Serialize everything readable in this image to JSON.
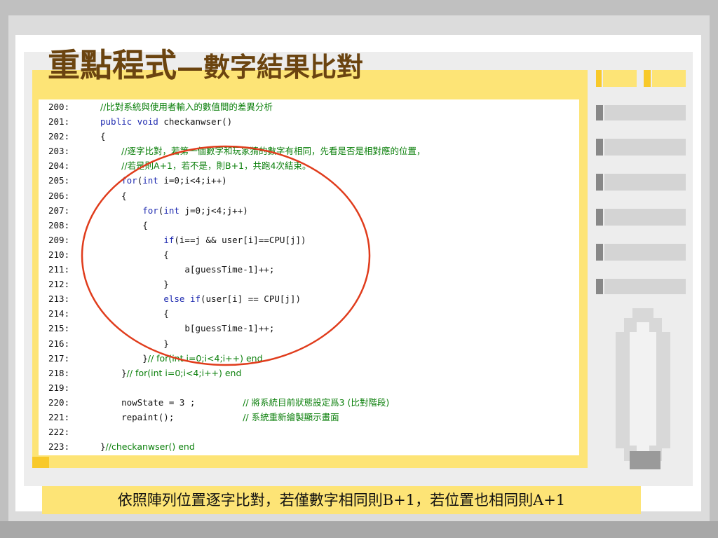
{
  "title": {
    "main": "重點程式",
    "sub": "—數字結果比對"
  },
  "code_lines": [
    {
      "num": "200:",
      "parts": [
        {
          "text": "//比對系統與使用者輸入的數值間的差異分析",
          "type": "comment"
        }
      ]
    },
    {
      "num": "201:",
      "parts": [
        {
          "text": "public void ",
          "type": "keyword"
        },
        {
          "text": "checkanwser()",
          "type": "plain"
        }
      ]
    },
    {
      "num": "202:",
      "parts": [
        {
          "text": "{",
          "type": "plain"
        }
      ]
    },
    {
      "num": "203:",
      "parts": [
        {
          "text": "    ",
          "type": "plain"
        },
        {
          "text": "//逐字比對，若第一個數字和玩家猜的數字有相同，先看是否是相對應的位置，",
          "type": "comment"
        }
      ]
    },
    {
      "num": "204:",
      "parts": [
        {
          "text": "    ",
          "type": "plain"
        },
        {
          "text": "//若是則A+1，若不是，則B+1，共跑4次結束。",
          "type": "comment"
        }
      ]
    },
    {
      "num": "205:",
      "parts": [
        {
          "text": "    ",
          "type": "plain"
        },
        {
          "text": "for",
          "type": "keyword"
        },
        {
          "text": "(",
          "type": "plain"
        },
        {
          "text": "int",
          "type": "keyword"
        },
        {
          "text": " i=0;i<4;i++)",
          "type": "plain"
        }
      ]
    },
    {
      "num": "206:",
      "parts": [
        {
          "text": "    {",
          "type": "plain"
        }
      ]
    },
    {
      "num": "207:",
      "parts": [
        {
          "text": "        ",
          "type": "plain"
        },
        {
          "text": "for",
          "type": "keyword"
        },
        {
          "text": "(",
          "type": "plain"
        },
        {
          "text": "int",
          "type": "keyword"
        },
        {
          "text": " j=0;j<4;j++)",
          "type": "plain"
        }
      ]
    },
    {
      "num": "208:",
      "parts": [
        {
          "text": "        {",
          "type": "plain"
        }
      ]
    },
    {
      "num": "209:",
      "parts": [
        {
          "text": "            ",
          "type": "plain"
        },
        {
          "text": "if",
          "type": "keyword"
        },
        {
          "text": "(i==j && user[i]==CPU[j])",
          "type": "plain"
        }
      ]
    },
    {
      "num": "210:",
      "parts": [
        {
          "text": "            {",
          "type": "plain"
        }
      ]
    },
    {
      "num": "211:",
      "parts": [
        {
          "text": "                a[guessTime-1]++;",
          "type": "plain"
        }
      ]
    },
    {
      "num": "212:",
      "parts": [
        {
          "text": "            }",
          "type": "plain"
        }
      ]
    },
    {
      "num": "213:",
      "parts": [
        {
          "text": "            ",
          "type": "plain"
        },
        {
          "text": "else if",
          "type": "keyword"
        },
        {
          "text": "(user[i] == CPU[j])",
          "type": "plain"
        }
      ]
    },
    {
      "num": "214:",
      "parts": [
        {
          "text": "            {",
          "type": "plain"
        }
      ]
    },
    {
      "num": "215:",
      "parts": [
        {
          "text": "                b[guessTime-1]++;",
          "type": "plain"
        }
      ]
    },
    {
      "num": "216:",
      "parts": [
        {
          "text": "            }",
          "type": "plain"
        }
      ]
    },
    {
      "num": "217:",
      "parts": [
        {
          "text": "        }",
          "type": "plain"
        },
        {
          "text": "// for(int i=0;i<4;i++) end",
          "type": "comment"
        }
      ]
    },
    {
      "num": "218:",
      "parts": [
        {
          "text": "    }",
          "type": "plain"
        },
        {
          "text": "// for(int i=0;i<4;i++) end",
          "type": "comment"
        }
      ]
    },
    {
      "num": "219:",
      "parts": []
    },
    {
      "num": "220:",
      "parts": [
        {
          "text": "    nowState = 3 ;         ",
          "type": "plain"
        },
        {
          "text": "// 將系統目前狀態設定爲3 (比對階段)",
          "type": "comment"
        }
      ]
    },
    {
      "num": "221:",
      "parts": [
        {
          "text": "    repaint();             ",
          "type": "plain"
        },
        {
          "text": "// 系統重新繪製顯示畫面",
          "type": "comment"
        }
      ]
    },
    {
      "num": "222:",
      "parts": []
    },
    {
      "num": "223:",
      "parts": [
        {
          "text": "}",
          "type": "plain"
        },
        {
          "text": "//checkanwser() end",
          "type": "comment"
        }
      ]
    }
  ],
  "caption": "依照陣列位置逐字比對，若僅數字相同則B+1，若位置也相同則A+1",
  "colors": {
    "title": "#6b4410",
    "comment": "#0a7f0a",
    "keyword": "#1f2bb0",
    "highlight_circle": "#e03c1c",
    "yellow_panel": "#fde476"
  }
}
